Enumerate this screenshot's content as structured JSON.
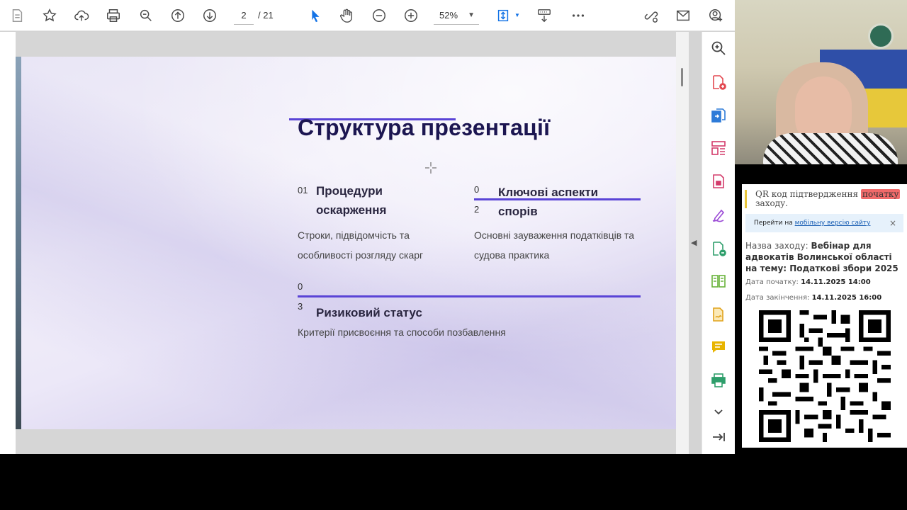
{
  "toolbar": {
    "page_current": "2",
    "page_total": "/ 21",
    "zoom": "52%"
  },
  "slide": {
    "title": "Структура презентації",
    "items": [
      {
        "number": "01",
        "heading_line1": "Процедури",
        "heading_line2": "оскарження",
        "desc_line1": "Строки, підвідомчість та",
        "desc_line2": "особливості розгляду скарг"
      },
      {
        "number_top": "0",
        "number_bottom": "2",
        "heading_line1": "Ключові аспекти",
        "heading_line2": "спорів",
        "desc_line1": "Основні зауваження податківців та",
        "desc_line2": "судова практика"
      },
      {
        "number_top": "0",
        "number_bottom": "3",
        "heading": "Ризиковий статус",
        "desc": "Критерії присвоєння та способи позбавлення"
      }
    ]
  },
  "info_panel": {
    "qr_note_prefix": "QR код підтвердження",
    "qr_note_highlight": "початку",
    "qr_note_suffix": "заходу.",
    "mobile_prefix": "Перейти на",
    "mobile_link": "мобільну версію сайту",
    "close_label": "×",
    "event_label": "Назва заходу:",
    "event_name": "Вебінар для адвокатів Волинської області на тему: Податкові збори 2025",
    "start_label": "Дата початку:",
    "start_value": "14.11.2025 14:00",
    "end_label": "Дата закінчення:",
    "end_value": "14.11.2025 16:00"
  },
  "colors": {
    "accent": "#5a44d6",
    "title": "#1c1651",
    "adobe_blue": "#1473e6"
  }
}
